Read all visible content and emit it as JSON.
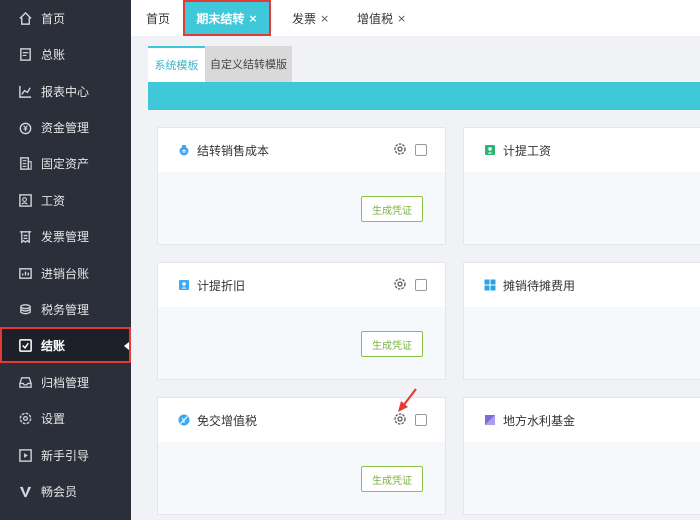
{
  "sidebar": {
    "items": [
      {
        "label": "首页",
        "icon": "home-icon"
      },
      {
        "label": "总账",
        "icon": "ledger-icon"
      },
      {
        "label": "报表中心",
        "icon": "chart-icon"
      },
      {
        "label": "资金管理",
        "icon": "money-icon"
      },
      {
        "label": "固定资产",
        "icon": "building-icon"
      },
      {
        "label": "工资",
        "icon": "salary-icon"
      },
      {
        "label": "发票管理",
        "icon": "invoice-icon"
      },
      {
        "label": "进销台账",
        "icon": "register-icon"
      },
      {
        "label": "税务管理",
        "icon": "tax-icon"
      },
      {
        "label": "结账",
        "icon": "closing-icon"
      },
      {
        "label": "归档管理",
        "icon": "archive-icon"
      },
      {
        "label": "设置",
        "icon": "gear-icon"
      },
      {
        "label": "新手引导",
        "icon": "play-icon"
      },
      {
        "label": "畅会员",
        "icon": "vip-icon"
      }
    ],
    "active_index": 9
  },
  "top_tabs": {
    "home": "首页",
    "period_end": "期末结转",
    "invoice": "发票",
    "vat": "增值税",
    "close_symbol": "×"
  },
  "sub_tabs": {
    "system": "系统模板",
    "custom": "自定义结转模版"
  },
  "cards": [
    {
      "title": "结转销售成本",
      "button": "生成凭证",
      "icon_color": "#3fa9f5"
    },
    {
      "title": "计提工资",
      "icon_color": "#2bb673"
    },
    {
      "title": "计提折旧",
      "button": "生成凭证",
      "icon_color": "#3fa9f5"
    },
    {
      "title": "摊销待摊费用",
      "icon_color": "#29a3e6"
    },
    {
      "title": "免交增值税",
      "button": "生成凭证",
      "icon_color": "#3fa9f5"
    },
    {
      "title": "地方水利基金",
      "icon_color": "#7b6fd6"
    }
  ],
  "colors": {
    "accent": "#3fc8d9",
    "highlight": "#e53935",
    "sidebar_bg": "#2b2f3a",
    "button_green": "#7cb342"
  }
}
